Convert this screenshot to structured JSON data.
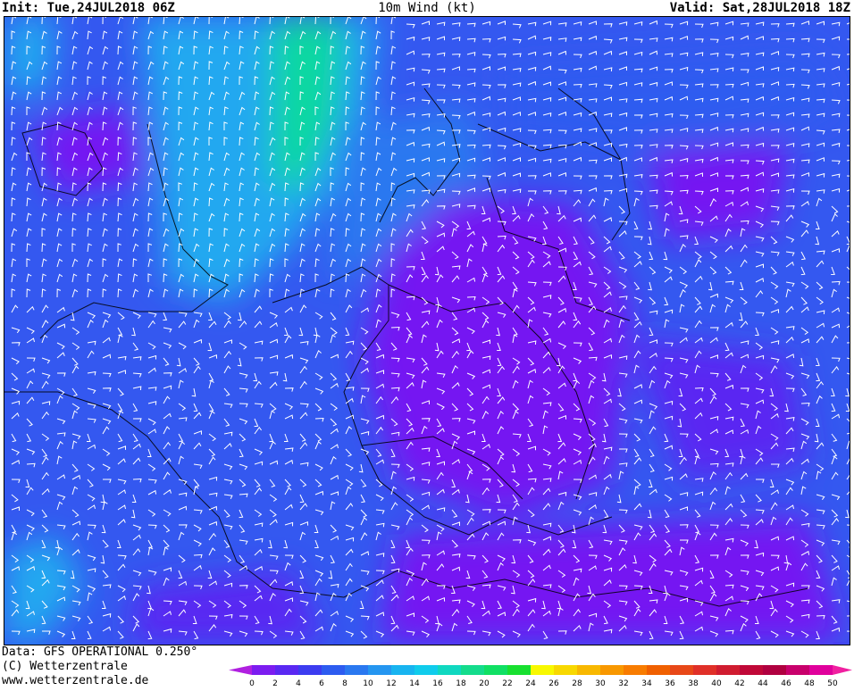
{
  "header": {
    "init": "Init: Tue,24JUL2018 06Z",
    "title": "10m  Wind  (kt)",
    "valid": "Valid: Sat,28JUL2018 18Z"
  },
  "footer": {
    "data_source": "Data: GFS OPERATIONAL 0.250°",
    "copyright": "(C) Wetterzentrale",
    "url": "www.wetterzentrale.de"
  },
  "legend": {
    "labels": [
      "0",
      "2",
      "4",
      "6",
      "8",
      "10",
      "12",
      "14",
      "16",
      "18",
      "20",
      "22",
      "24",
      "26",
      "28",
      "30",
      "32",
      "34",
      "36",
      "38",
      "40",
      "42",
      "44",
      "46",
      "48",
      "50"
    ],
    "colors": [
      "#7c1cf0",
      "#5a28f2",
      "#3c3cf0",
      "#2d5cf0",
      "#2a78f0",
      "#2596f0",
      "#18b4f0",
      "#10ccec",
      "#10d8c0",
      "#14dc8c",
      "#10e064",
      "#18e030",
      "#f8f800",
      "#f8d800",
      "#f8b800",
      "#f89800",
      "#f87c00",
      "#f06000",
      "#e84818",
      "#e03028",
      "#d01c30",
      "#c00838",
      "#b00040",
      "#c8006c",
      "#e0009c"
    ],
    "arrow_left": "#b020e0",
    "arrow_right": "#f020a0"
  },
  "map_colors": {
    "base": "#3458f0",
    "calm": "#7418f2",
    "moderate": "#22a8f0",
    "strong": "#10d8a0",
    "barb": "#ffffff",
    "coast": "#000000"
  }
}
